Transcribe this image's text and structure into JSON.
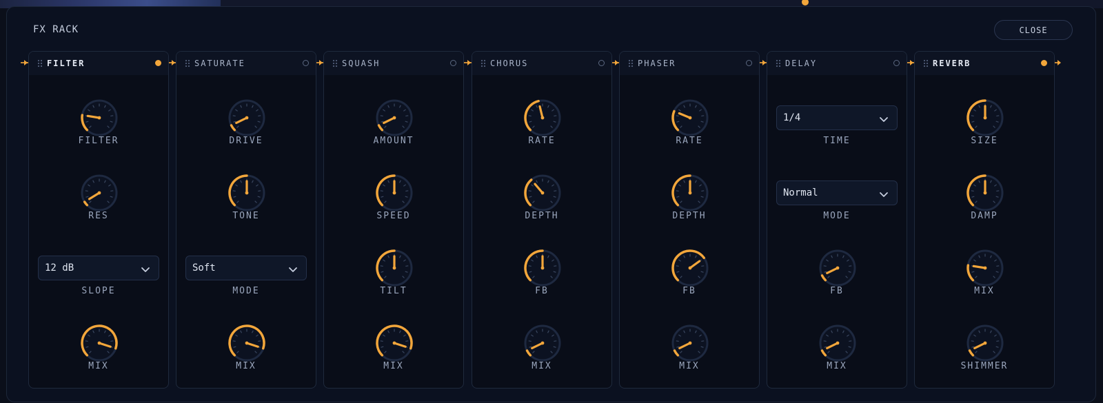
{
  "rack_title": "FX RACK",
  "close_label": "CLOSE",
  "colors": {
    "accent": "#f2a63b",
    "panel": "#0b1120",
    "track": "#1e2940"
  },
  "modules": [
    {
      "name": "FILTER",
      "enabled": true,
      "params": [
        {
          "type": "knob",
          "label": "FILTER",
          "value": 0.2
        },
        {
          "type": "knob",
          "label": "RES",
          "value": 0.05
        },
        {
          "type": "select",
          "label": "SLOPE",
          "value": "12 dB"
        },
        {
          "type": "knob",
          "label": "MIX",
          "value": 0.9
        }
      ]
    },
    {
      "name": "SATURATE",
      "enabled": false,
      "params": [
        {
          "type": "knob",
          "label": "DRIVE",
          "value": 0.07
        },
        {
          "type": "knob",
          "label": "TONE",
          "value": 0.5
        },
        {
          "type": "select",
          "label": "MODE",
          "value": "Soft"
        },
        {
          "type": "knob",
          "label": "MIX",
          "value": 0.9
        }
      ]
    },
    {
      "name": "SQUASH",
      "enabled": false,
      "params": [
        {
          "type": "knob",
          "label": "AMOUNT",
          "value": 0.07
        },
        {
          "type": "knob",
          "label": "SPEED",
          "value": 0.5
        },
        {
          "type": "knob",
          "label": "TILT",
          "value": 0.5
        },
        {
          "type": "knob",
          "label": "MIX",
          "value": 0.9
        }
      ]
    },
    {
      "name": "CHORUS",
      "enabled": false,
      "params": [
        {
          "type": "knob",
          "label": "RATE",
          "value": 0.45
        },
        {
          "type": "knob",
          "label": "DEPTH",
          "value": 0.35
        },
        {
          "type": "knob",
          "label": "FB",
          "value": 0.5
        },
        {
          "type": "knob",
          "label": "MIX",
          "value": 0.07
        }
      ]
    },
    {
      "name": "PHASER",
      "enabled": false,
      "params": [
        {
          "type": "knob",
          "label": "RATE",
          "value": 0.25
        },
        {
          "type": "knob",
          "label": "DEPTH",
          "value": 0.5
        },
        {
          "type": "knob",
          "label": "FB",
          "value": 0.7
        },
        {
          "type": "knob",
          "label": "MIX",
          "value": 0.07
        }
      ]
    },
    {
      "name": "DELAY",
      "enabled": false,
      "params": [
        {
          "type": "select",
          "label": "TIME",
          "value": "1/4"
        },
        {
          "type": "select",
          "label": "MODE",
          "value": "Normal"
        },
        {
          "type": "knob",
          "label": "FB",
          "value": 0.07
        },
        {
          "type": "knob",
          "label": "MIX",
          "value": 0.07
        }
      ]
    },
    {
      "name": "REVERB",
      "enabled": true,
      "params": [
        {
          "type": "knob",
          "label": "SIZE",
          "value": 0.5
        },
        {
          "type": "knob",
          "label": "DAMP",
          "value": 0.5
        },
        {
          "type": "knob",
          "label": "MIX",
          "value": 0.2
        },
        {
          "type": "knob",
          "label": "SHIMMER",
          "value": 0.07
        }
      ]
    }
  ]
}
